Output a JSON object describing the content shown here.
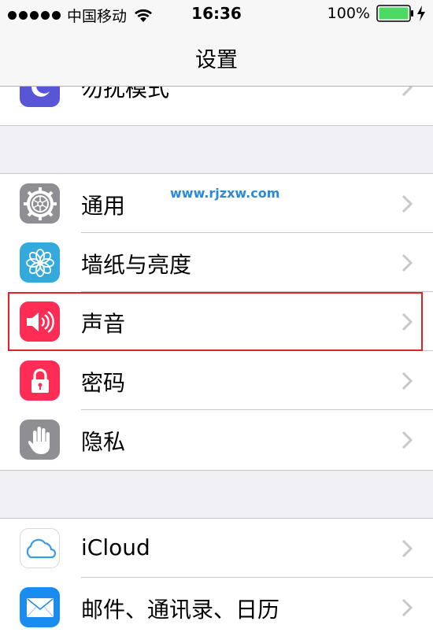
{
  "status_bar": {
    "carrier": "中国移动",
    "time": "16:36",
    "battery_percent": "100%"
  },
  "nav": {
    "title": "设置"
  },
  "watermark": "www.rjzxw.com",
  "groups": [
    {
      "rows": [
        {
          "label": "勿扰模式",
          "icon": "moon-icon",
          "color": "#5856d6"
        }
      ]
    },
    {
      "rows": [
        {
          "label": "通用",
          "icon": "gear-icon",
          "color": "#8e8e93"
        },
        {
          "label": "墙纸与亮度",
          "icon": "flower-icon",
          "color": "#34aadc"
        },
        {
          "label": "声音",
          "icon": "speaker-icon",
          "color": "#ff2d55",
          "highlighted": true
        },
        {
          "label": "密码",
          "icon": "lock-icon",
          "color": "#ff2d55"
        },
        {
          "label": "隐私",
          "icon": "hand-icon",
          "color": "#8e8e93"
        }
      ]
    },
    {
      "rows": [
        {
          "label": "iCloud",
          "icon": "cloud-icon",
          "color": "#ffffff"
        },
        {
          "label": "邮件、通讯录、日历",
          "icon": "mail-icon",
          "color": "#1a8cf0"
        }
      ]
    }
  ]
}
